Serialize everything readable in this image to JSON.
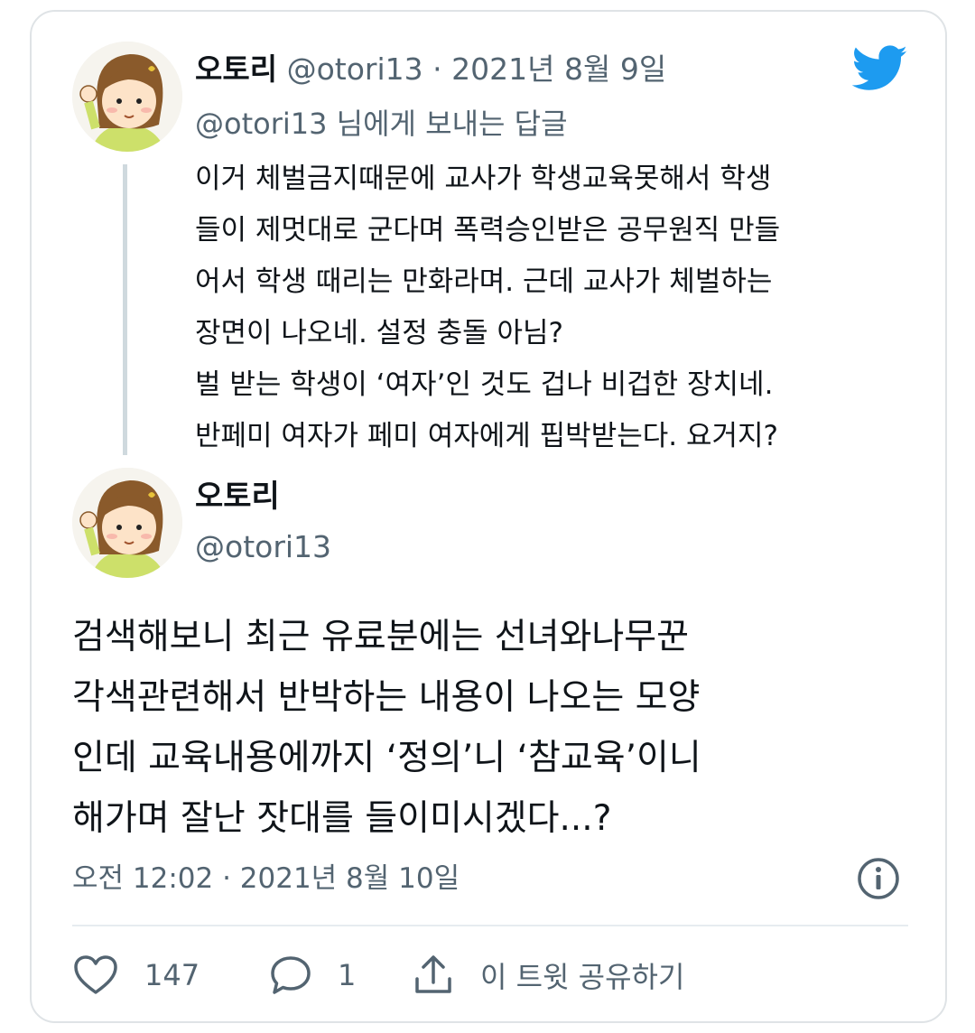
{
  "reply_tweet": {
    "display_name": "오토리",
    "handle": "@otori13",
    "date": "2021년 8월 9일",
    "separator": "·",
    "replying_to": "@otori13 님에게 보내는 답글",
    "lines": [
      "이거 체벌금지때문에 교사가 학생교육못해서 학생",
      "들이 제멋대로 군다며 폭력승인받은 공무원직 만들",
      "어서 학생 때리는 만화라며. 근데 교사가 체벌하는",
      "장면이 나오네. 설정 충돌 아님?",
      "벌 받는 학생이 ‘여자’인 것도 겁나 비겁한 장치네.",
      "반페미 여자가 페미 여자에게 핍박받는다. 요거지?"
    ]
  },
  "main_tweet": {
    "display_name": "오토리",
    "handle": "@otori13",
    "lines": [
      "검색해보니 최근 유료분에는 선녀와나무꾼",
      "각색관련해서 반박하는 내용이 나오는 모양",
      "인데 교육내용에까지 ‘정의’니 ‘참교육’이니",
      "해가며 잘난 잣대를 들이미시겠다...?"
    ],
    "timestamp": "오전 12:02 · 2021년 8월 10일"
  },
  "actions": {
    "like_count": "147",
    "reply_count": "1",
    "share_label": "이 트윗 공유하기"
  },
  "icons": {
    "brand": "twitter-bird-icon",
    "info": "info-icon",
    "like": "heart-icon",
    "reply": "comment-icon",
    "share": "share-icon"
  },
  "colors": {
    "twitter_blue": "#1d9bf0",
    "secondary_text": "#536471",
    "primary_text": "#0f1419",
    "thread_line": "#cfd9de"
  }
}
